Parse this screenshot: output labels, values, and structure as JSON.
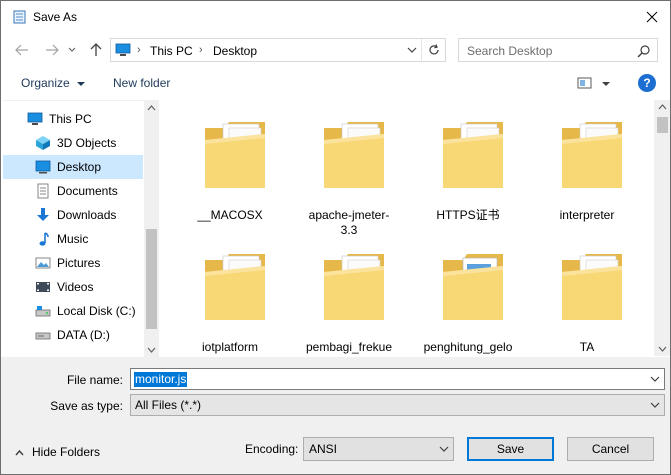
{
  "window": {
    "title": "Save As"
  },
  "address": {
    "segments": [
      "This PC",
      "Desktop"
    ]
  },
  "search": {
    "placeholder": "Search Desktop"
  },
  "toolbar": {
    "organize": "Organize",
    "new_folder": "New folder",
    "help": "?"
  },
  "nav": {
    "items": [
      {
        "label": "This PC",
        "icon": "pc-icon",
        "root": true,
        "selected": false
      },
      {
        "label": "3D Objects",
        "icon": "3d-objects-icon",
        "root": false,
        "selected": false
      },
      {
        "label": "Desktop",
        "icon": "desktop-icon",
        "root": false,
        "selected": true
      },
      {
        "label": "Documents",
        "icon": "documents-icon",
        "root": false,
        "selected": false
      },
      {
        "label": "Downloads",
        "icon": "downloads-icon",
        "root": false,
        "selected": false
      },
      {
        "label": "Music",
        "icon": "music-icon",
        "root": false,
        "selected": false
      },
      {
        "label": "Pictures",
        "icon": "pictures-icon",
        "root": false,
        "selected": false
      },
      {
        "label": "Videos",
        "icon": "videos-icon",
        "root": false,
        "selected": false
      },
      {
        "label": "Local Disk (C:)",
        "icon": "local-disk-icon",
        "root": false,
        "selected": false
      },
      {
        "label": "DATA (D:)",
        "icon": "data-drive-icon",
        "root": false,
        "selected": false
      }
    ]
  },
  "folders": [
    {
      "label": "__MACOSX"
    },
    {
      "label": "apache-jmeter-3.3"
    },
    {
      "label": "HTTPS证书"
    },
    {
      "label": "interpreter"
    },
    {
      "label": "iotplatform"
    },
    {
      "label": "pembagi_frekuensi"
    },
    {
      "label": "penghitung_gelombang"
    },
    {
      "label": "TA"
    }
  ],
  "form": {
    "filename_label": "File name:",
    "filename_value": "monitor.js",
    "savetype_label": "Save as type:",
    "savetype_value": "All Files  (*.*)",
    "hide_folders": "Hide Folders",
    "encoding_label": "Encoding:",
    "encoding_value": "ANSI",
    "save": "Save",
    "cancel": "Cancel"
  },
  "colors": {
    "selection": "#cce8ff",
    "accent": "#0078d7",
    "folder": "#f8d775"
  }
}
